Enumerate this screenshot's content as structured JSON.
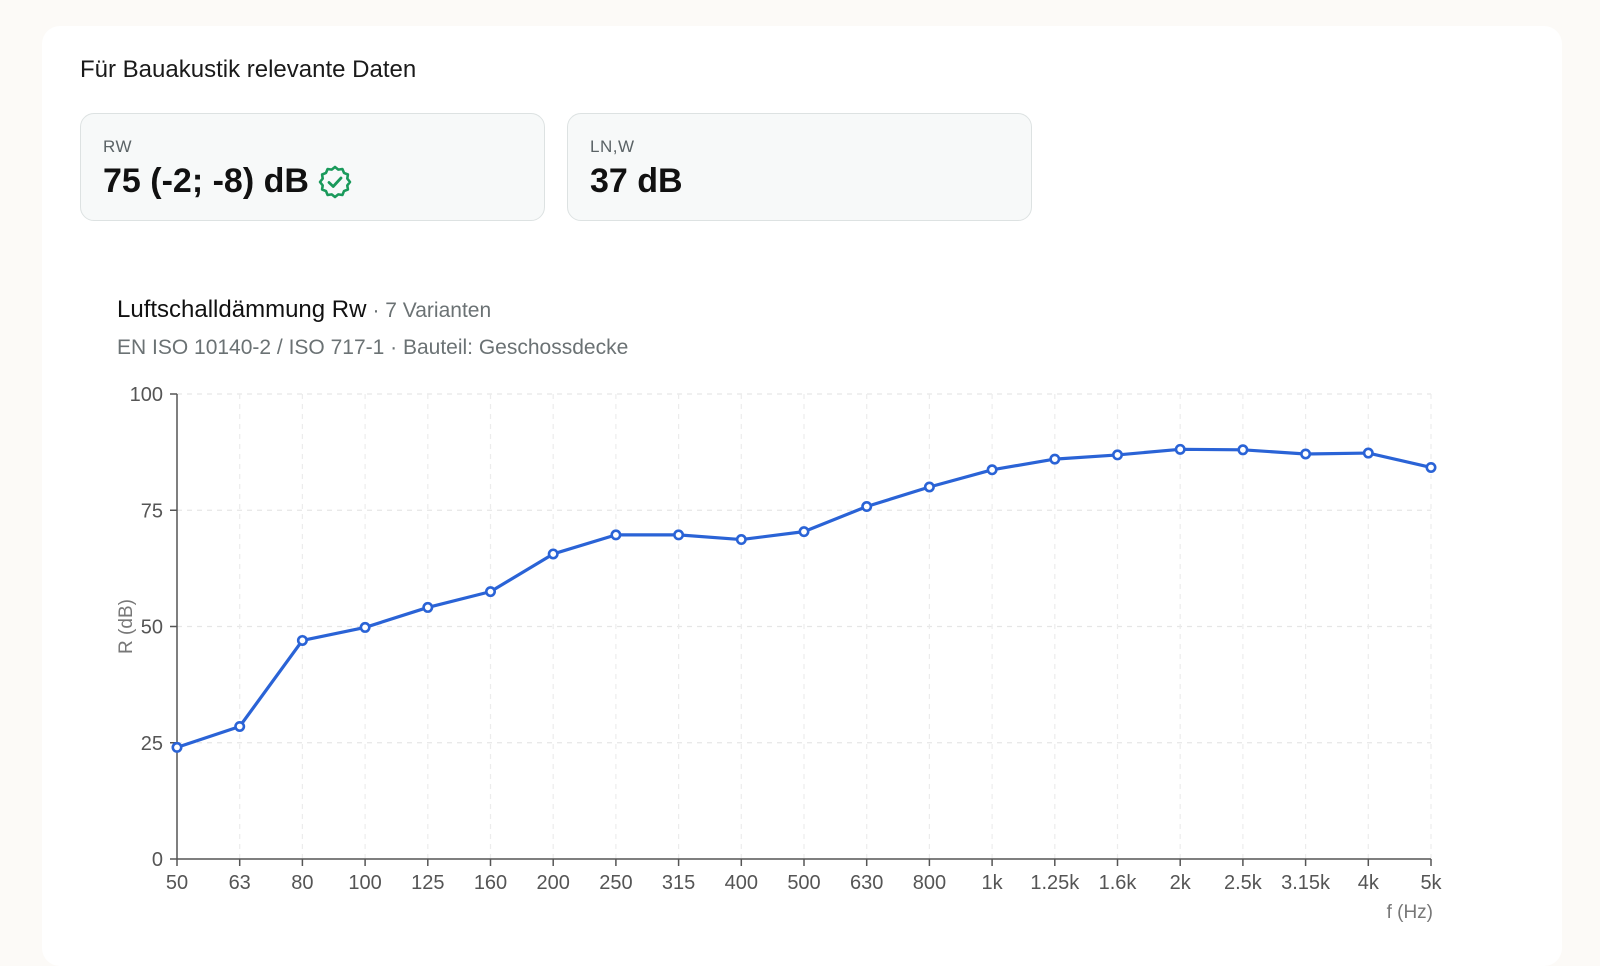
{
  "section": {
    "title": "Für Bauakustik relevante Daten"
  },
  "metrics": {
    "rw": {
      "label": "RW",
      "value": "75 (-2; -8) dB",
      "verified_icon": "verified-badge-icon",
      "verified_color": "#1a9a5b"
    },
    "ln": {
      "label": "LN,W",
      "value": "37 dB"
    }
  },
  "chart_header": {
    "title": "Luftschalldämmung Rw",
    "variants": "· 7 Varianten",
    "subtitle": "EN ISO 10140-2 / ISO 717-1 · Bauteil: Geschossdecke"
  },
  "chart_data": {
    "type": "line",
    "categories": [
      "50",
      "63",
      "80",
      "100",
      "125",
      "160",
      "200",
      "250",
      "315",
      "400",
      "500",
      "630",
      "800",
      "1k",
      "1.25k",
      "1.6k",
      "2k",
      "2.5k",
      "3.15k",
      "4k",
      "5k"
    ],
    "series": [
      {
        "values": [
          24,
          28.5,
          47,
          49.8,
          54.1,
          57.5,
          65.6,
          69.7,
          69.7,
          68.7,
          70.4,
          75.8,
          80,
          83.7,
          86,
          86.9,
          88.1,
          88,
          87.1,
          87.3,
          84.2
        ]
      }
    ],
    "xlabel": "f (Hz)",
    "ylabel": "R (dB)",
    "ylim": [
      0,
      100
    ],
    "yticks": [
      0,
      25,
      50,
      75,
      100
    ],
    "grid": true,
    "line_color": "#2a63d6"
  }
}
